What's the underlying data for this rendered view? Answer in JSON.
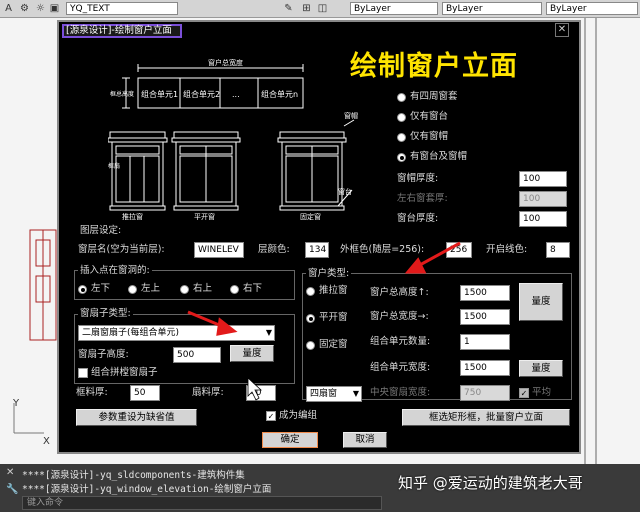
{
  "toolbar": {
    "text_style": "YQ_TEXT",
    "layer_1": "ByLayer",
    "layer_2": "ByLayer",
    "layer_3": "ByLayer"
  },
  "dialog": {
    "title": "[源泉设计]-绘制窗户立面",
    "overlay_title": "绘制窗户立面",
    "preview": {
      "window_overall_width": "窗户总宽度",
      "frame_height": "框总高度",
      "cells": [
        "组合单元1",
        "组合单元2",
        "...",
        "组合单元n"
      ],
      "sill_label": "窗帽",
      "ledge_label": "窗台",
      "window_types": [
        "推拉窗",
        "平开窗",
        "固定窗"
      ],
      "frame_label": "框扇"
    },
    "accessory_options": [
      {
        "label": "有四周窗套",
        "selected": false
      },
      {
        "label": "仅有窗台",
        "selected": false
      },
      {
        "label": "仅有窗帽",
        "selected": false
      },
      {
        "label": "有窗台及窗帽",
        "selected": true
      }
    ],
    "sill_thickness": {
      "label": "窗帽厚度:",
      "value": "100"
    },
    "side_cover_thickness": {
      "label": "左右窗套厚:",
      "value": "100"
    },
    "ledge_thickness": {
      "label": "窗台厚度:",
      "value": "100"
    },
    "layer_settings": {
      "title": "图层设定:",
      "layer_name_label": "窗层名(空为当前层):",
      "layer_name_value": "WINELEV",
      "layer_color_label": "层颜色:",
      "layer_color_value": "134",
      "outer_frame_color_label": "外框色(随层=256):",
      "outer_frame_color_value": "256",
      "opening_color_label": "开启线色:",
      "opening_color_value": "8"
    },
    "insert_point": {
      "title": "插入点在窗洞的:",
      "options": [
        {
          "label": "左下",
          "selected": true
        },
        {
          "label": "左上",
          "selected": false
        },
        {
          "label": "右上",
          "selected": false
        },
        {
          "label": "右下",
          "selected": false
        }
      ]
    },
    "sash_type": {
      "title": "窗扇子类型:",
      "selected": "二扇窗扇子(每组合单元)",
      "sash_height_label": "窗扇子高度:",
      "sash_height_value": "500",
      "measure_label": "量度",
      "combine_checkbox": "组合拼樘窗扇子"
    },
    "frame_thickness": {
      "label": "框料厚:",
      "value": "50"
    },
    "sash_thickness": {
      "label": "扇料厚:",
      "value": "40"
    },
    "reset_button": "参数重设为缺省值",
    "group_checkbox": "成为编组",
    "window_type": {
      "title": "窗户类型:",
      "options": [
        {
          "label": "推拉窗",
          "selected": false
        },
        {
          "label": "平开窗",
          "selected": true
        },
        {
          "label": "固定窗",
          "selected": false
        }
      ],
      "total_height_label": "窗户总高度↑:",
      "total_height_value": "1500",
      "total_width_label": "窗户总宽度→:",
      "total_width_value": "1500",
      "unit_count_label": "组合单元数量:",
      "unit_count_value": "1",
      "unit_width_label": "组合单元宽度:",
      "unit_width_value": "1500",
      "measure_label": "量度",
      "leaf_select": "四扇窗",
      "mid_width_label": "中央窗扇宽度:",
      "mid_width_value": "750",
      "equal_checkbox": "平均"
    },
    "batch_button": "框选矩形框，批量窗户立面",
    "ok_button": "确定",
    "cancel_button": "取消"
  },
  "command": {
    "line1": "****[源泉设计]-yq_sldcomponents-建筑构件集",
    "line2": "****[源泉设计]-yq_window_elevation-绘制窗户立面",
    "prompt": "键入命令"
  },
  "watermark": "知乎 @爱运动的建筑老大哥",
  "colors": {
    "dialog_bg": "#000000",
    "overlay_title": "#ffe400",
    "preview_lines": "#ffffff",
    "arrow": "#e21a1a",
    "title_border": "#7b4fd9"
  }
}
